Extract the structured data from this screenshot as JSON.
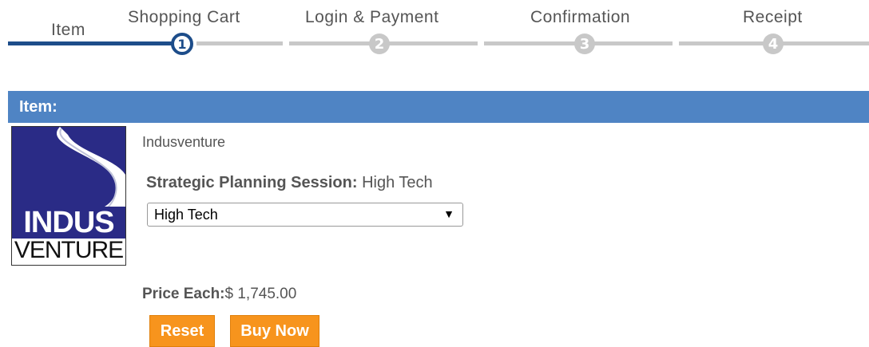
{
  "steps": [
    {
      "label": "Item"
    },
    {
      "label": "Shopping Cart",
      "number": "1"
    },
    {
      "label": "Login & Payment",
      "number": "2"
    },
    {
      "label": "Confirmation",
      "number": "3"
    },
    {
      "label": "Receipt",
      "number": "4"
    }
  ],
  "item_header": "Item:",
  "logo": {
    "line1": "INDUS",
    "line2": "VENTURE",
    "colors": {
      "bg": "#2a2b86"
    }
  },
  "vendor": "Indusventure",
  "session": {
    "label": "Strategic Planning Session:",
    "value": "High Tech"
  },
  "select": {
    "value": "High Tech"
  },
  "price": {
    "label": "Price Each:",
    "value": "$ 1,745.00"
  },
  "buttons": {
    "reset": "Reset",
    "buy_now": "Buy Now"
  },
  "colors": {
    "header": "#4f84c4",
    "button": "#f7941d",
    "active_step": "#1d4d8a",
    "inactive_step": "#c8c8c8"
  }
}
